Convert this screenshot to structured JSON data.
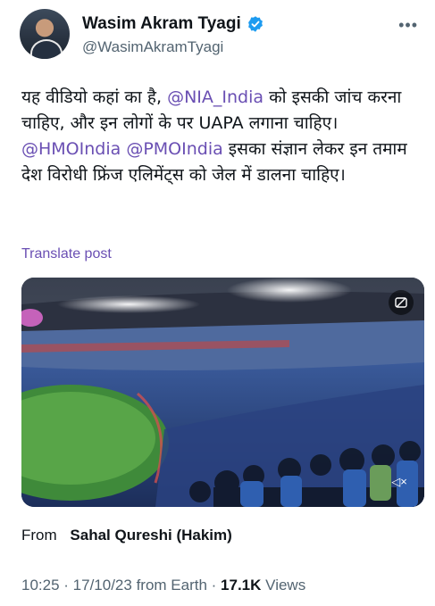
{
  "author": {
    "name": "Wasim Akram Tyagi",
    "handle": "@WasimAkramTyagi"
  },
  "tweet": {
    "line1_a": "यह वीडियो कहां का है, ",
    "mention_nia": "@NIA_India",
    "line1_b": " को इसकी जांच करना चाहिए, और इन लोगों के पर UAPA लगाना चाहिए।",
    "mention_hmo": "@HMOIndia",
    "mention_pmo": "@PMOIndia",
    "line3_b": " इसका संज्ञान लेकर इन तमाम देश विरोधी फ्रिंज एलिमेंट्स को जेल में डालना चाहिए।"
  },
  "translate_label": "Translate post",
  "media": {
    "top_icon": "gif-icon",
    "bottom_icon": "mute-icon",
    "mute_glyph": "◁×"
  },
  "source": {
    "label": "From",
    "name": "Sahal Qureshi (Hakim)"
  },
  "meta": {
    "time": "10:25",
    "date": "17/10/23",
    "location": "from Earth",
    "views_count": "17.1K",
    "views_label": "Views"
  },
  "colors": {
    "mention": "#6a4fb3",
    "verified": "#1d9bf0",
    "secondary_text": "#536471"
  }
}
